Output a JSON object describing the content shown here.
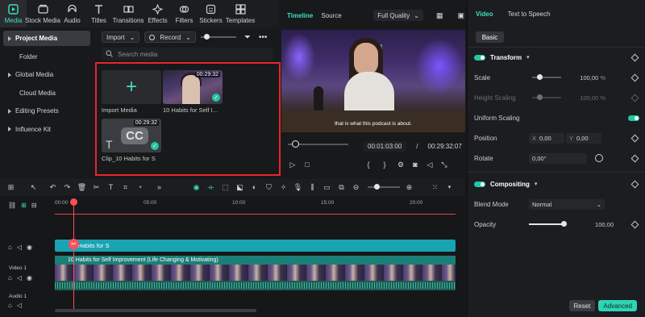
{
  "toolbar": {
    "items": [
      {
        "label": "Media",
        "icon": "media-icon"
      },
      {
        "label": "Stock Media",
        "icon": "stock-media-icon"
      },
      {
        "label": "Audio",
        "icon": "audio-icon"
      },
      {
        "label": "Titles",
        "icon": "titles-icon"
      },
      {
        "label": "Transitions",
        "icon": "transitions-icon"
      },
      {
        "label": "Effects",
        "icon": "effects-icon"
      },
      {
        "label": "Filters",
        "icon": "filters-icon"
      },
      {
        "label": "Stickers",
        "icon": "stickers-icon"
      },
      {
        "label": "Templates",
        "icon": "templates-icon"
      }
    ],
    "accent": "#3ce0c0"
  },
  "sidebar": {
    "items": [
      {
        "label": "Project Media"
      },
      {
        "label": "Folder"
      },
      {
        "label": "Global Media"
      },
      {
        "label": "Cloud Media"
      },
      {
        "label": "Editing Presets"
      },
      {
        "label": "Influence Kit"
      }
    ]
  },
  "media": {
    "import_label": "Import",
    "record_label": "Record",
    "search_placeholder": "Search media",
    "cards": [
      {
        "name": "Import Media"
      },
      {
        "name": "10 Habits for Self I...",
        "duration": "00:29:32"
      },
      {
        "name": "Clip_10 Habits for S",
        "duration": "00:29:32"
      }
    ]
  },
  "player": {
    "tabs": [
      "Timeline",
      "Source"
    ],
    "quality": "Full Quality",
    "subtitle": "that is what this podcast is about.",
    "current_time": "00:01:03:00",
    "separator": "/",
    "total_time": "00:29:32:07"
  },
  "properties": {
    "tabs": [
      "Video",
      "Text to Speech"
    ],
    "basic_label": "Basic",
    "transform": {
      "label": "Transform",
      "scale_label": "Scale",
      "scale_value": "100,00",
      "scale_unit": "%",
      "height_label": "Height Scaling",
      "height_value": "100,00",
      "height_unit": "%",
      "uniform_label": "Uniform Scaling",
      "position_label": "Position",
      "x_label": "X",
      "x_value": "0,00",
      "y_label": "Y",
      "y_value": "0,00",
      "rotate_label": "Rotate",
      "rotate_value": "0,00°"
    },
    "compositing": {
      "label": "Compositing",
      "blend_label": "Blend Mode",
      "blend_value": "Normal",
      "opacity_label": "Opacity",
      "opacity_value": "100,00"
    },
    "reset_label": "Reset",
    "advanced_label": "Advanced"
  },
  "timeline": {
    "ruler": [
      "00:00",
      "05:00",
      "10:00",
      "15:00",
      "20:00"
    ],
    "title_clip": "10 Habits for S",
    "video_clip": "10 Habits for Self Improvement (Life Changing & Motivating)",
    "video_track_label": "Video 1",
    "audio_track_label": "Audio 1"
  }
}
